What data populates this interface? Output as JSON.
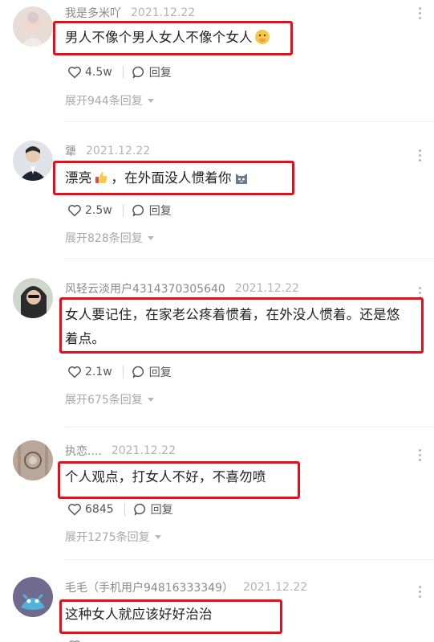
{
  "comments": [
    {
      "user": "我是多米吖",
      "time": "2021.12.22",
      "text": "男人不像个男人女人不像个女人",
      "emoji": "face-with-hand-over-mouth",
      "likes": "4.5w",
      "reply_label": "回复",
      "expand_label": "展开944条回复"
    },
    {
      "user": "犟",
      "time": "2021.12.22",
      "text_a": "漂亮",
      "emoji_a": "thumbs-up",
      "text_b": "，在外面没人惯着你",
      "emoji_b": "cat-face",
      "likes": "2.5w",
      "reply_label": "回复",
      "expand_label": "展开828条回复"
    },
    {
      "user": "风轻云淡用户4314370305640",
      "time": "2021.12.22",
      "line1": "女人要记住，在家老公疼着惯着，在外没人惯着。还是悠",
      "line2": "着点。",
      "likes": "2.1w",
      "reply_label": "回复",
      "expand_label": "展开675条回复"
    },
    {
      "user": "执恋....",
      "time": "2021.12.22",
      "text": "个人观点，打女人不好，不喜勿喷",
      "likes": "6845",
      "reply_label": "回复",
      "expand_label": "展开1275条回复"
    },
    {
      "user": "毛毛（手机用户94816333349）",
      "time": "2021.12.22",
      "text": "这种女人就应该好好治治"
    }
  ],
  "colors": {
    "highlight": "#e3101c",
    "meta": "#8a8a8a"
  }
}
